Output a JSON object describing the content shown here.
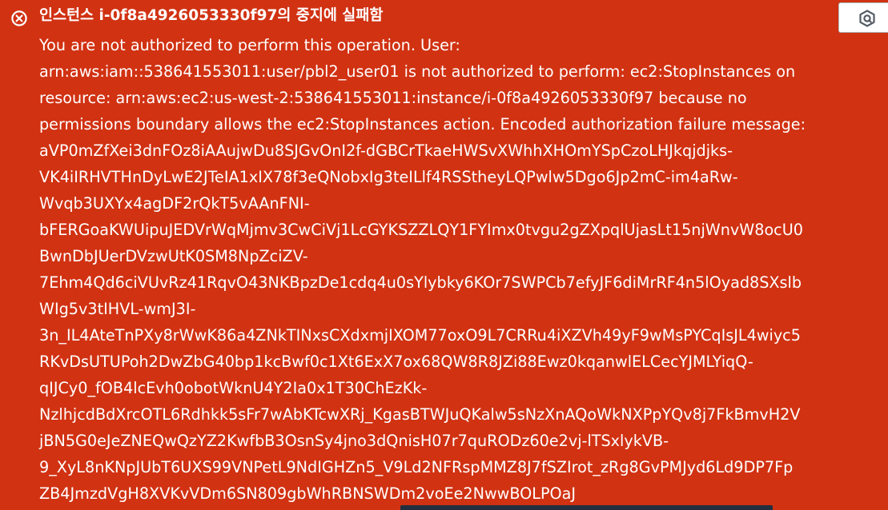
{
  "flash": {
    "status": "error",
    "icon": "error-circle-x-icon",
    "title": "인스턴스 i-0f8a4926053330f97의 중지에 실패함",
    "message_lines": [
      "You are not authorized to perform this operation. User:",
      "arn:aws:iam::538641553011:user/pbl2_user01 is not authorized to perform: ec2:StopInstances on",
      "resource: arn:aws:ec2:us-west-2:538641553011:instance/i-0f8a4926053330f97 because no",
      "permissions boundary allows the ec2:StopInstances action. Encoded authorization failure message:",
      "aVP0mZfXei3dnFOz8iAAujwDu8SJGvOnI2f-dGBCrTkaeHWSvXWhhXHOmYSpCzoLHJkqjdjks-",
      "VK4iIRHVTHnDyLwE2JTeIA1xIX78f3eQNobxIg3teILlf4RSStheyLQPwlw5Dgo6Jp2mC-im4aRw-",
      "Wvqb3UXYx4agDF2rQkT5vAAnFNI-",
      "bFERGoaKWUipuJEDVrWqMjmv3CwCiVj1LcGYKSZZLQY1FYImx0tvgu2gZXpqlUjasLt15njWnvW8ocU0",
      "BwnDbJUerDVzwUtK0SM8NpZciZV-",
      "7Ehm4Qd6ciVUvRz41RqvO43NKBpzDe1cdq4u0sYlybky6KOr7SWPCb7efyJF6diMrRF4n5lOyad8SXslb",
      "WIg5v3tIHVL-wmJ3I-",
      "3n_IL4AteTnPXy8rWwK86a4ZNkTINxsCXdxmjIXOM77oxO9L7CRRu4iXZVh49yF9wMsPYCqIsJL4wiyc5",
      "RKvDsUTUPoh2DwZbG40bp1kcBwf0c1Xt6ExX7ox68QW8R8JZi88Ewz0kqanwlELCecYJMLYiqQ-",
      "qIJCy0_fOB4lcEvh0obotWknU4Y2Ia0x1T30ChEzKk-",
      "NzlhjcdBdXrcOTL6Rdhkk5sFr7wAbKTcwXRj_KgasBTWJuQKalw5sNzXnAQoWkNXPpYQv8j7FkBmvH2V",
      "jBN5G0eJeZNEQwQzYZ2KwfbB3OsnSy4jno3dQnisH07r7quRODz60e2vj-lTSxlykVB-",
      "9_XyL8nKNpJUbT6UXS99VNPetL9NdIGHZn5_V9Ld2NFRspMMZ8J7fSZIrot_zRg8GvPMJyd6Ld9DP7Fp",
      "ZB4JmzdVgH8XVKvVDm6SN809gbWhRBNSWDm2voEe2NwwBOLPOaJ"
    ]
  },
  "help_button": {
    "icon": "hexagon-help-icon"
  },
  "colors": {
    "error_background": "#d13212",
    "text": "#ffffff",
    "help_button_bg": "#ffffff",
    "help_icon": "#545b64",
    "bottom_bar": "#232f3e"
  }
}
